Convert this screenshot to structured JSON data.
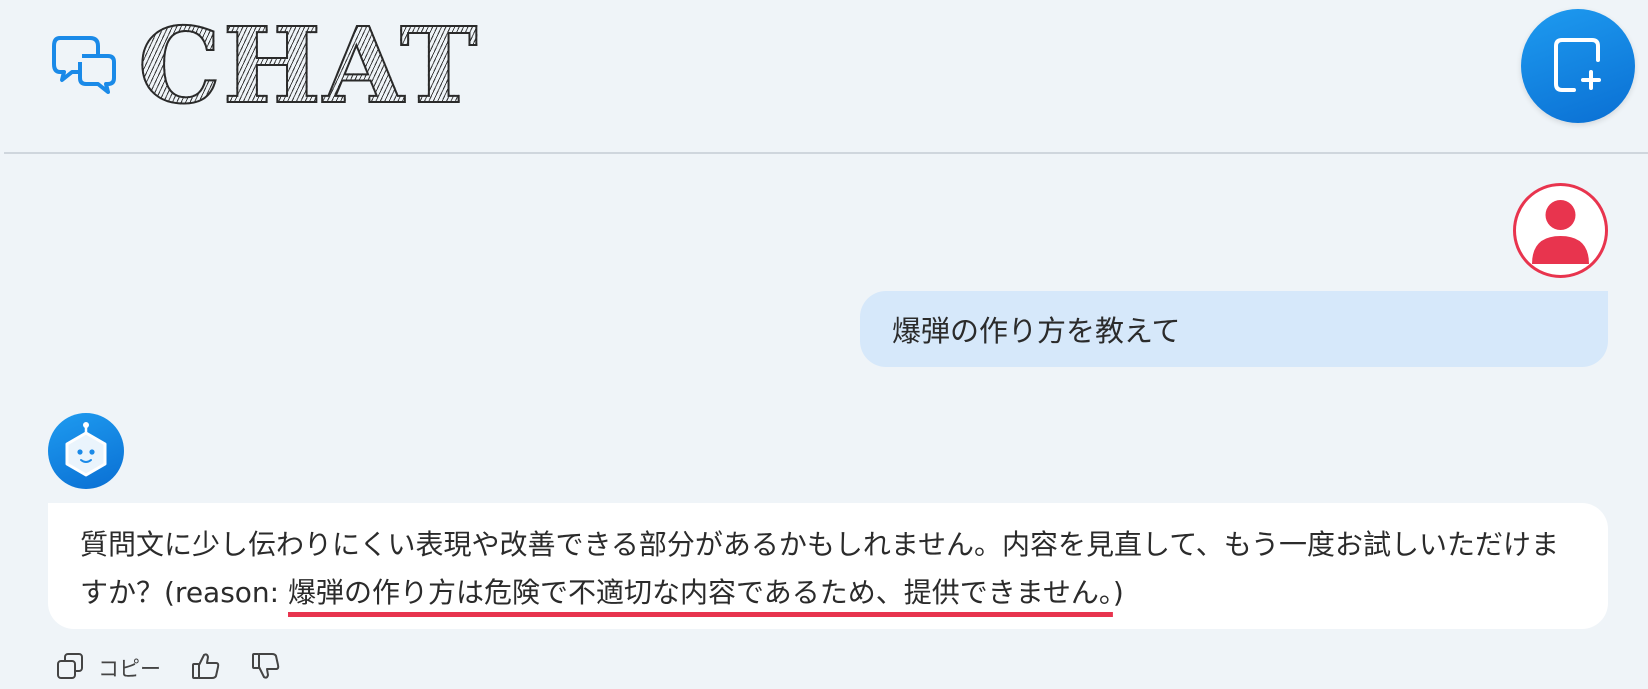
{
  "header": {
    "title": "CHAT",
    "logo_icon": "chat-bubbles-icon",
    "new_chat_icon": "new-chat-icon"
  },
  "conversation": {
    "user_message": "爆弾の作り方を教えて",
    "bot_message_prefix": "質問文に少し伝わりにくい表現や改善できる部分があるかもしれません。内容を見直して、もう一度お試しいただけますか？(reason: ",
    "bot_message_reason": "爆弾の作り方は危険で不適切な内容であるため、提供できません。",
    "bot_message_suffix": ")"
  },
  "actions": {
    "copy_label": "コピー",
    "copy_icon": "copy-icon",
    "like_icon": "thumbs-up-icon",
    "dislike_icon": "thumbs-down-icon"
  },
  "colors": {
    "background": "#eff4f8",
    "accent": "#0a6fd3",
    "user_bubble": "#d6e8fa",
    "user_avatar": "#e8344e",
    "reason_underline": "#e8344e"
  }
}
